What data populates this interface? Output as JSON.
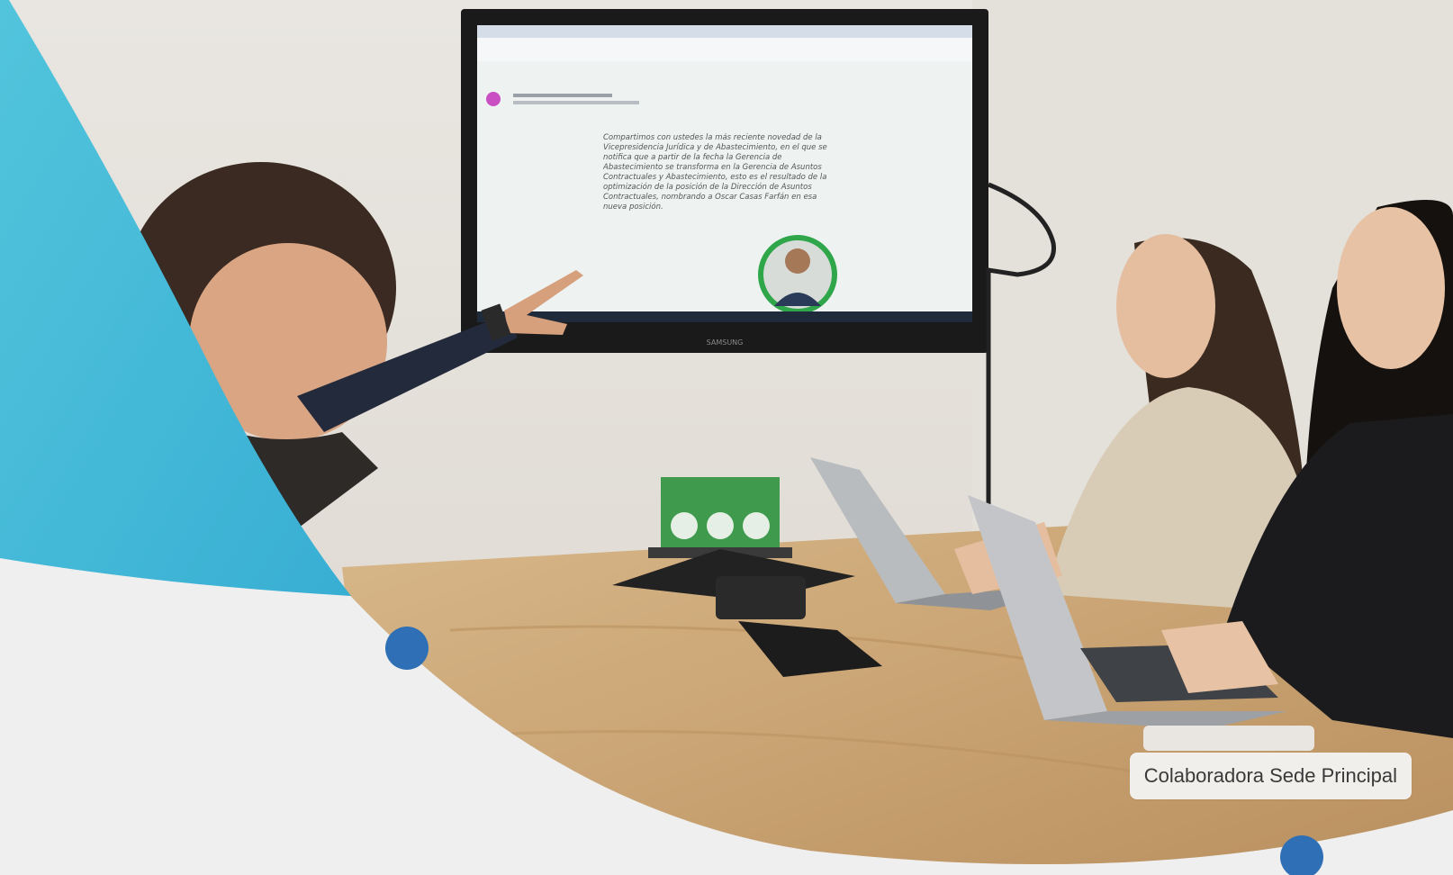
{
  "photo": {
    "caption": "Colaboradora Sede Principal",
    "screen_text": "Compartimos con ustedes la más reciente novedad de la Vicepresidencia Jurídica y de Abastecimiento, en el que se notifica que a partir de la fecha la Gerencia de Abastecimiento se transforma en la Gerencia de Asuntos Contractuales y Abastecimiento, esto es el resultado de la optimización de la posición de la Dirección de Asuntos Contractuales, nombrando a Oscar Casas Farfán en esa nueva posición.",
    "tv_brand": "SAMSUNG"
  },
  "colors": {
    "accent_cyan": "#45bcd8",
    "accent_dot": "#2f6fb6",
    "background": "#efefef"
  }
}
